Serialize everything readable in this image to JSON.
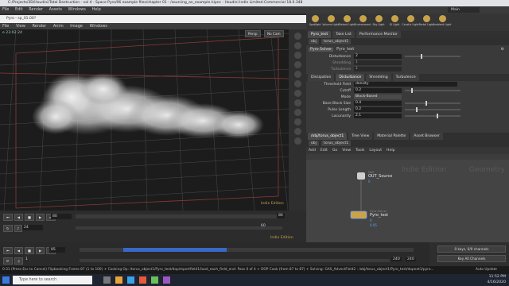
{
  "window": {
    "title": "C:/Projects/3D/Houdini/Total Destruction - vol 4 - Space Pyro/06 example files/chapter 01 - /sourcing_an_example.hipnc - Houdini Indie Limited-Commercial 18.0.348"
  },
  "main_menu": [
    "File",
    "Edit",
    "Render",
    "Assets",
    "Windows",
    "Help"
  ],
  "floating_window": {
    "title": "Pyro - sp_01.00?"
  },
  "viewport_menu": [
    "File",
    "View",
    "Render",
    "Anim",
    "Image",
    "Windows"
  ],
  "viewport": {
    "camera_label": "Persp",
    "no_cam_label": "No Cam",
    "frame_label": "e 23:02:24",
    "watermark": "Indie Edition"
  },
  "timeline1": {
    "current_frame": "80",
    "end_frame": "86",
    "start_frame": "24",
    "frame_marker": "60",
    "watermark": "Indie Edition"
  },
  "timeline2": {
    "start": "1",
    "current_field": "85",
    "end_a": "240",
    "end_b": "240",
    "keys_label": "0 keys, 0/0 channels",
    "key_all_label": "Key All Channels",
    "auto_update": "Auto Update"
  },
  "right_menu_label": "Main",
  "right_shelf": {
    "icons": [
      "Spotlight",
      "Volume Light",
      "Distant Light",
      "Environment",
      "Sky Light",
      "GI Light",
      "Caustic Light",
      "Portal Light",
      "Ambient Light"
    ]
  },
  "param_panel": {
    "tabs": [
      "Pyro_test",
      "Take List",
      "Performance Monitor"
    ],
    "path": [
      "obj",
      "torus_object1"
    ],
    "node_type": "Pyro Solver",
    "node_name": "Pyro_test",
    "rows_top": [
      {
        "label": "Disturbance",
        "value": "2"
      },
      {
        "label": "Shredding",
        "value": "1"
      },
      {
        "label": "Turbulence",
        "value": "1"
      }
    ],
    "sub_tabs": [
      "Dissipation",
      "Disturbance",
      "Shredding",
      "Turbulence"
    ],
    "rows": [
      {
        "label": "Threshold Field",
        "value": "density"
      },
      {
        "label": "Cutoff",
        "value": "0.2"
      },
      {
        "label": "Mode",
        "value": "Block-Based"
      },
      {
        "label": "Base Block Size",
        "value": "0.4"
      },
      {
        "label": "Pulse Length",
        "value": "0.2"
      },
      {
        "label": "Lacunarity",
        "value": "2.1"
      }
    ]
  },
  "network": {
    "tabs": [
      "/obj/torus_object1",
      "Tree View",
      "Material Palette",
      "Asset Browser"
    ],
    "path": [
      "obj",
      "torus_object1"
    ],
    "menu": [
      "Add",
      "Edit",
      "Go",
      "View",
      "Tools",
      "Layout",
      "Help"
    ],
    "watermark": "Indie Edition",
    "context_label": "Geometry",
    "nodes": [
      {
        "type": "Null",
        "name": "OUT_Source",
        "info": "0"
      },
      {
        "type": "Pyro Solver",
        "name": "Pyro_test",
        "info": "0",
        "extra": "0.05"
      }
    ]
  },
  "status": {
    "message": "0:31 (Press Esc to Cancel) Flipbooking Frame 87 (1 to 100) + Cooking Op: /torus_object1/Pyro_test/dopimportfield1/load_each_field_end: Pass 0 of 4 + DOP Cook (from 87 to 87) + Solving: GAS_AdvectField2 : /obj/torus_object1/Pyro_test/dopnet1/pyro..."
  },
  "taskbar": {
    "search_placeholder": "Type here to search",
    "time": "11:52 PM",
    "date": "4/16/2020"
  }
}
